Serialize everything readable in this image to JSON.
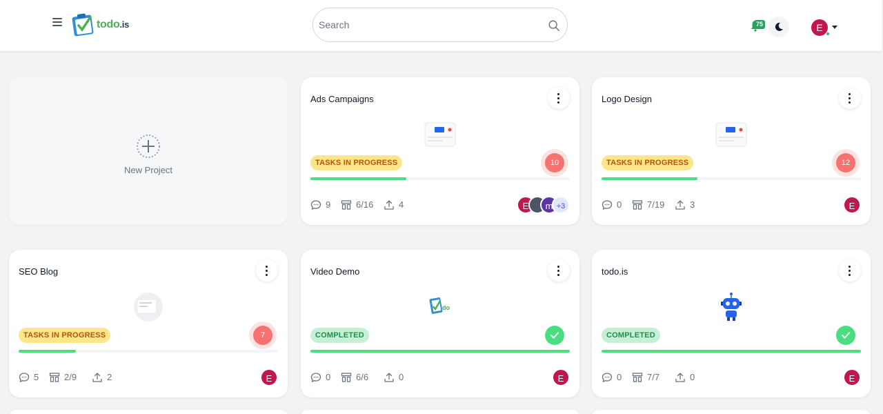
{
  "header": {
    "logo_text": "todo",
    "logo_suffix": ".is",
    "search_placeholder": "Search",
    "notification_count": "75",
    "user_initial": "E"
  },
  "new_project": {
    "label": "New Project"
  },
  "projects": [
    {
      "title": "Ads Campaigns",
      "status": "TASKS IN PROGRESS",
      "status_kind": "progress",
      "badge": "10",
      "progress": 0.37,
      "comments": "9",
      "tasks": "6/16",
      "uploads": "4",
      "members": [
        "E",
        "photo",
        "m",
        "+3"
      ]
    },
    {
      "title": "Logo Design",
      "status": "TASKS IN PROGRESS",
      "status_kind": "progress",
      "badge": "12",
      "progress": 0.37,
      "comments": "0",
      "tasks": "7/19",
      "uploads": "3",
      "members": [
        "E"
      ]
    },
    {
      "title": "SEO Blog",
      "status": "TASKS IN PROGRESS",
      "status_kind": "progress",
      "badge": "7",
      "progress": 0.22,
      "comments": "5",
      "tasks": "2/9",
      "uploads": "2",
      "members": [
        "E"
      ]
    },
    {
      "title": "Video Demo",
      "status": "COMPLETED",
      "status_kind": "done",
      "badge": "",
      "progress": 1.0,
      "comments": "0",
      "tasks": "6/6",
      "uploads": "0",
      "members": [
        "E"
      ]
    },
    {
      "title": "todo.is",
      "status": "COMPLETED",
      "status_kind": "done",
      "badge": "",
      "progress": 1.0,
      "comments": "0",
      "tasks": "7/7",
      "uploads": "0",
      "members": [
        "E"
      ]
    }
  ],
  "icons": {
    "menu": "hamburger-icon",
    "search": "search-icon",
    "notification": "bell-icon",
    "theme": "moon-icon",
    "comments": "comment-icon",
    "tasks": "tasks-icon",
    "uploads": "upload-icon",
    "options": "more-vertical-icon",
    "done": "check-icon"
  },
  "colors": {
    "progress_badge_bg": "#fde68a",
    "progress_badge_text": "#b45309",
    "done_badge_bg": "#c6f0d5",
    "done_badge_text": "#1e8e4a",
    "progress_fill": "#4ade80",
    "count_badge": "#f87171",
    "avatar": "#c0174f"
  }
}
